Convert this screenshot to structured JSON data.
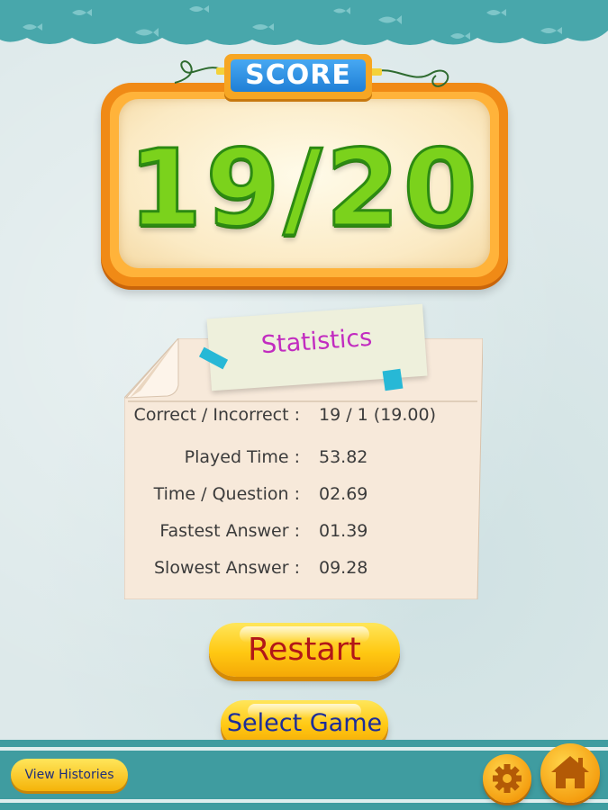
{
  "score": {
    "label": "SCORE",
    "value": "19/20"
  },
  "statistics": {
    "title": "Statistics",
    "rows": [
      {
        "label": "Correct / Incorrect :",
        "value": "19 / 1 (19.00)"
      },
      {
        "label": "Played Time :",
        "value": "53.82"
      },
      {
        "label": "Time / Question :",
        "value": "02.69"
      },
      {
        "label": "Fastest Answer :",
        "value": "01.39"
      },
      {
        "label": "Slowest Answer :",
        "value": "09.28"
      }
    ]
  },
  "buttons": {
    "restart": "Restart",
    "select_game": "Select Game",
    "view_histories": "View Histories"
  },
  "icons": {
    "settings": "gear-icon",
    "home": "home-icon",
    "fish": "fish-icon"
  },
  "colors": {
    "score_green": "#7bd21c",
    "frame_orange": "#f08a16",
    "label_blue": "#1f7fd6",
    "title_magenta": "#c22cc0",
    "button_yellow": "#ffc812",
    "restart_red": "#b21718",
    "select_blue": "#1b2d9a",
    "bar_teal": "#3f9ca0"
  }
}
